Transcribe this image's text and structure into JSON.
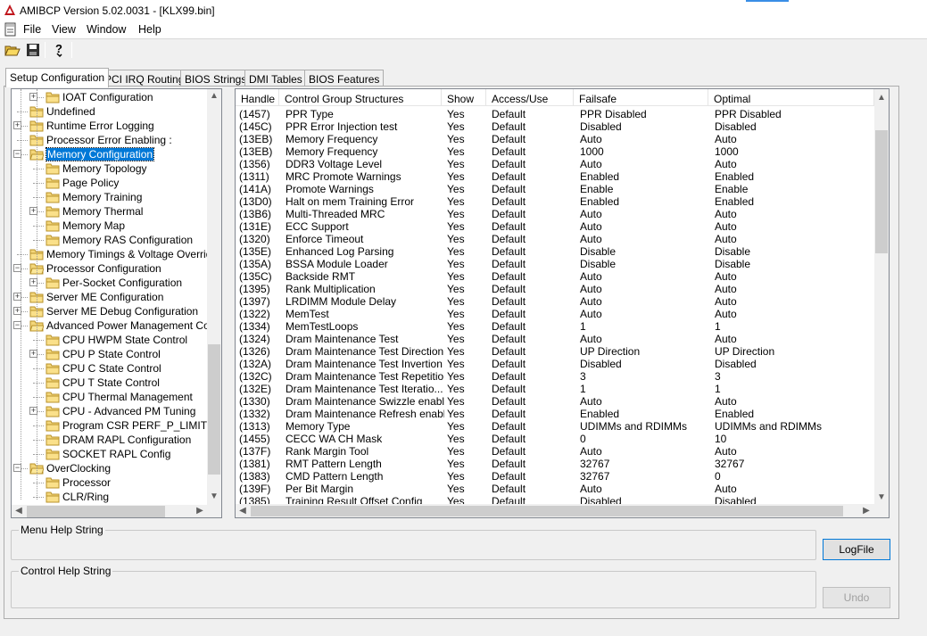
{
  "window": {
    "title": "AMIBCP Version 5.02.0031 - [KLX99.bin]"
  },
  "menu": [
    "File",
    "View",
    "Window",
    "Help"
  ],
  "toolbar": {
    "buttons": [
      "open-folder-icon",
      "save-icon",
      "help-icon"
    ]
  },
  "tabs": [
    {
      "label": "Setup Configuration",
      "active": true
    },
    {
      "label": "PCI IRQ Routing",
      "active": false
    },
    {
      "label": "BIOS Strings",
      "active": false
    },
    {
      "label": "DMI Tables",
      "active": false
    },
    {
      "label": "BIOS Features",
      "active": false
    }
  ],
  "tree": {
    "items": [
      {
        "label": "IOAT Configuration",
        "level": 2,
        "expander": "+"
      },
      {
        "label": "Undefined",
        "level": 1,
        "expander": ""
      },
      {
        "label": "Runtime Error Logging",
        "level": 1,
        "expander": "+"
      },
      {
        "label": "Processor Error Enabling :",
        "level": 1,
        "expander": ""
      },
      {
        "label": "Memory Configuration",
        "level": 1,
        "expander": "-",
        "selected": true,
        "open": true
      },
      {
        "label": "Memory Topology",
        "level": 2,
        "expander": ""
      },
      {
        "label": "Page Policy",
        "level": 2,
        "expander": ""
      },
      {
        "label": "Memory Training",
        "level": 2,
        "expander": ""
      },
      {
        "label": "Memory Thermal",
        "level": 2,
        "expander": "+"
      },
      {
        "label": "Memory Map",
        "level": 2,
        "expander": ""
      },
      {
        "label": "Memory RAS Configuration",
        "level": 2,
        "expander": ""
      },
      {
        "label": "Memory Timings & Voltage Override",
        "level": 1,
        "expander": ""
      },
      {
        "label": "Processor Configuration",
        "level": 1,
        "expander": "-",
        "open": true
      },
      {
        "label": "Per-Socket Configuration",
        "level": 2,
        "expander": "+"
      },
      {
        "label": "Server ME Configuration",
        "level": 1,
        "expander": "+"
      },
      {
        "label": "Server ME Debug Configuration",
        "level": 1,
        "expander": "+"
      },
      {
        "label": "Advanced Power Management Con",
        "level": 1,
        "expander": "-",
        "open": true
      },
      {
        "label": "CPU HWPM State Control",
        "level": 2,
        "expander": ""
      },
      {
        "label": "CPU P State Control",
        "level": 2,
        "expander": "+"
      },
      {
        "label": "CPU C State Control",
        "level": 2,
        "expander": ""
      },
      {
        "label": "CPU T State Control",
        "level": 2,
        "expander": ""
      },
      {
        "label": "CPU Thermal Management",
        "level": 2,
        "expander": ""
      },
      {
        "label": "CPU - Advanced PM Tuning",
        "level": 2,
        "expander": "+"
      },
      {
        "label": "Program CSR PERF_P_LIMIT",
        "level": 2,
        "expander": ""
      },
      {
        "label": "DRAM RAPL Configuration",
        "level": 2,
        "expander": ""
      },
      {
        "label": "SOCKET RAPL Config",
        "level": 2,
        "expander": ""
      },
      {
        "label": "OverClocking",
        "level": 1,
        "expander": "-",
        "open": true
      },
      {
        "label": "Processor",
        "level": 2,
        "expander": ""
      },
      {
        "label": "CLR/Ring",
        "level": 2,
        "expander": ""
      }
    ]
  },
  "grid": {
    "columns": [
      "Handle",
      "Control Group Structures",
      "Show",
      "Access/Use",
      "Failsafe",
      "Optimal"
    ],
    "rows": [
      [
        "(1457)",
        "PPR Type",
        "Yes",
        "Default",
        "PPR Disabled",
        "PPR Disabled"
      ],
      [
        "(145C)",
        "PPR Error Injection test",
        "Yes",
        "Default",
        "Disabled",
        "Disabled"
      ],
      [
        "(13EB)",
        "Memory Frequency",
        "Yes",
        "Default",
        "Auto",
        "Auto"
      ],
      [
        "(13EB)",
        "Memory Frequency",
        "Yes",
        "Default",
        "1000",
        "1000"
      ],
      [
        "(1356)",
        "DDR3 Voltage Level",
        "Yes",
        "Default",
        "Auto",
        "Auto"
      ],
      [
        "(1311)",
        "MRC Promote Warnings",
        "Yes",
        "Default",
        "Enabled",
        "Enabled"
      ],
      [
        "(141A)",
        "Promote Warnings",
        "Yes",
        "Default",
        "Enable",
        "Enable"
      ],
      [
        "(13D0)",
        "Halt on mem Training Error",
        "Yes",
        "Default",
        "Enabled",
        "Enabled"
      ],
      [
        "(13B6)",
        "Multi-Threaded MRC",
        "Yes",
        "Default",
        "Auto",
        "Auto"
      ],
      [
        "(131E)",
        "ECC Support",
        "Yes",
        "Default",
        "Auto",
        "Auto"
      ],
      [
        "(1320)",
        "Enforce Timeout",
        "Yes",
        "Default",
        "Auto",
        "Auto"
      ],
      [
        "(135E)",
        "Enhanced Log Parsing",
        "Yes",
        "Default",
        "Disable",
        "Disable"
      ],
      [
        "(135A)",
        "BSSA Module Loader",
        "Yes",
        "Default",
        "Disable",
        "Disable"
      ],
      [
        "(135C)",
        "Backside RMT",
        "Yes",
        "Default",
        "Auto",
        "Auto"
      ],
      [
        "(1395)",
        "Rank Multiplication",
        "Yes",
        "Default",
        "Auto",
        "Auto"
      ],
      [
        "(1397)",
        "LRDIMM Module Delay",
        "Yes",
        "Default",
        "Auto",
        "Auto"
      ],
      [
        "(1322)",
        "MemTest",
        "Yes",
        "Default",
        "Auto",
        "Auto"
      ],
      [
        "(1334)",
        "MemTestLoops",
        "Yes",
        "Default",
        "1",
        "1"
      ],
      [
        "(1324)",
        "Dram Maintenance Test",
        "Yes",
        "Default",
        "Auto",
        "Auto"
      ],
      [
        "(1326)",
        "Dram Maintenance Test Direction",
        "Yes",
        "Default",
        "UP Direction",
        "UP Direction"
      ],
      [
        "(132A)",
        "Dram Maintenance Test Invertion",
        "Yes",
        "Default",
        "Disabled",
        "Disabled"
      ],
      [
        "(132C)",
        "Dram Maintenance Test Repetitio...",
        "Yes",
        "Default",
        "3",
        "3"
      ],
      [
        "(132E)",
        "Dram Maintenance Test Iteratio...",
        "Yes",
        "Default",
        "1",
        "1"
      ],
      [
        "(1330)",
        "Dram Maintenance Swizzle enabli...",
        "Yes",
        "Default",
        "Auto",
        "Auto"
      ],
      [
        "(1332)",
        "Dram Maintenance Refresh enabl...",
        "Yes",
        "Default",
        "Enabled",
        "Enabled"
      ],
      [
        "(1313)",
        "Memory Type",
        "Yes",
        "Default",
        "UDIMMs and RDIMMs",
        "UDIMMs and RDIMMs"
      ],
      [
        "(1455)",
        "CECC WA CH Mask",
        "Yes",
        "Default",
        "0",
        "10"
      ],
      [
        "(137F)",
        "Rank Margin Tool",
        "Yes",
        "Default",
        "Auto",
        "Auto"
      ],
      [
        "(1381)",
        "RMT Pattern Length",
        "Yes",
        "Default",
        "32767",
        "32767"
      ],
      [
        "(1383)",
        "CMD Pattern Length",
        "Yes",
        "Default",
        "32767",
        "0"
      ],
      [
        "(139F)",
        "Per Bit Margin",
        "Yes",
        "Default",
        "Auto",
        "Auto"
      ],
      [
        "(1385)",
        "Training Result Offset Config",
        "Yes",
        "Default",
        "Disabled",
        "Disabled"
      ]
    ]
  },
  "help": {
    "menu_help_label": "Menu Help String",
    "control_help_label": "Control Help String"
  },
  "buttons": {
    "logfile": "LogFile",
    "undo": "Undo"
  }
}
